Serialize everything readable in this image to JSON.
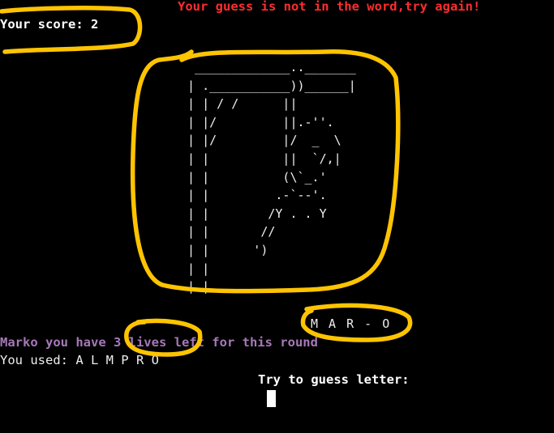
{
  "terminal": {
    "error_message": "Your guess is not in the word,try again!",
    "score_line": "Your score: 2",
    "word_progress": "M A R - O",
    "lives_line": "Marko you have 3 lives left for this round",
    "used_line": "You used: A L M P R O",
    "prompt": "Try to guess letter:"
  },
  "gallows_art": [
    "  _____________.._______",
    " | .___________))______|",
    " | | / /      ||",
    " | |/         ||.-''.",
    " | |/         |/  _  \\",
    " | |          ||  `/,|",
    " | |          (\\`_.'",
    " | |         .-`--'.",
    " | |        /Y . . Y",
    " | |       //",
    " | |      ')",
    " | |",
    " | |"
  ],
  "colors": {
    "background": "#000000",
    "error": "#ff2d2d",
    "text": "#eeeeee",
    "lives": "#a678b8",
    "annotation": "#ffc400"
  }
}
